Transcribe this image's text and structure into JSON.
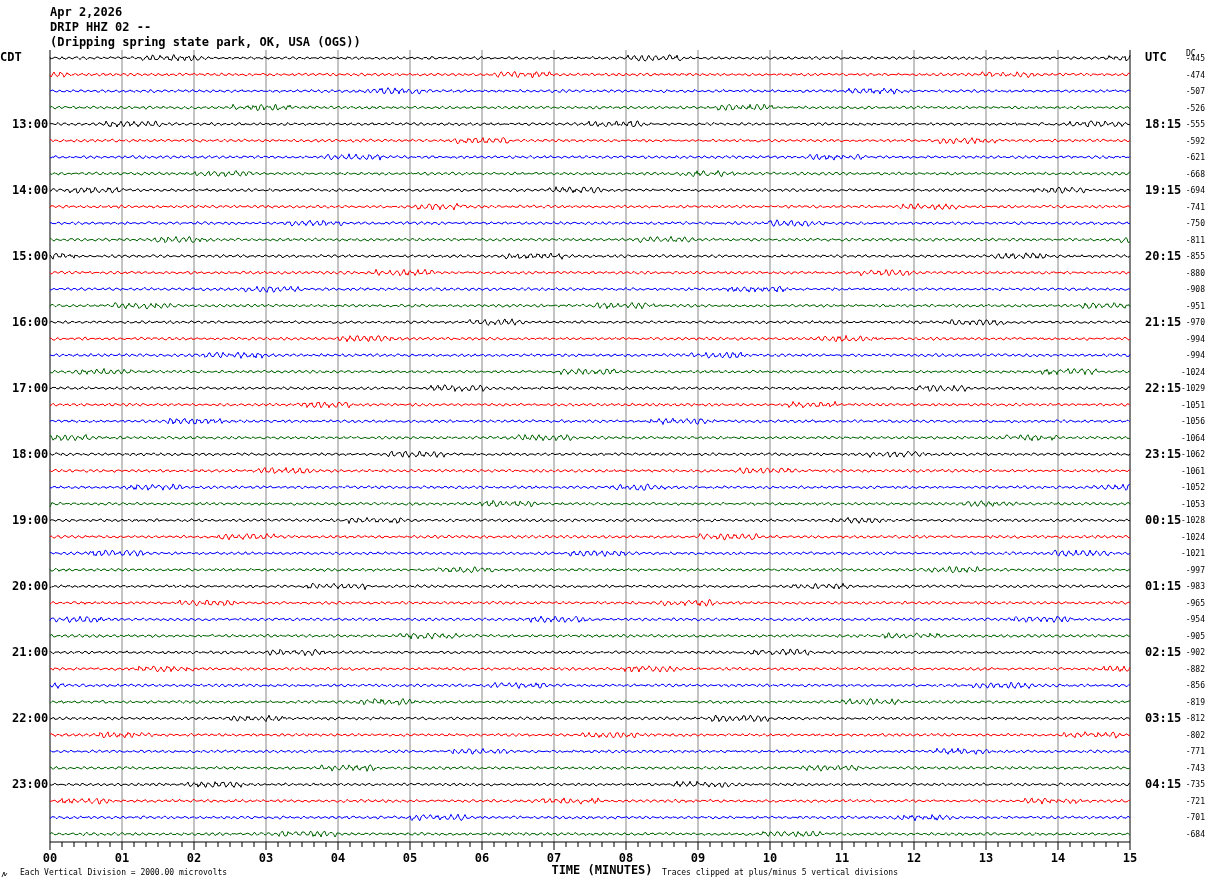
{
  "header": {
    "date": "Apr 2,2026",
    "station": "DRIP HHZ 02 --",
    "location": "(Dripping spring state park, OK, USA (OGS))"
  },
  "left_axis_title": "CDT",
  "right_axis_title": "UTC",
  "dc_title": "DC",
  "rows": [
    {
      "cdt": "",
      "utc": "",
      "dc": "-445",
      "color": "#000000"
    },
    {
      "cdt": "",
      "utc": "",
      "dc": "-474",
      "color": "#ff0000"
    },
    {
      "cdt": "",
      "utc": "",
      "dc": "-507",
      "color": "#0000ff"
    },
    {
      "cdt": "",
      "utc": "",
      "dc": "-526",
      "color": "#006400"
    },
    {
      "cdt": "13:00",
      "utc": "18:15",
      "dc": "-555",
      "color": "#000000"
    },
    {
      "cdt": "",
      "utc": "",
      "dc": "-592",
      "color": "#ff0000"
    },
    {
      "cdt": "",
      "utc": "",
      "dc": "-621",
      "color": "#0000ff"
    },
    {
      "cdt": "",
      "utc": "",
      "dc": "-668",
      "color": "#006400"
    },
    {
      "cdt": "14:00",
      "utc": "19:15",
      "dc": "-694",
      "color": "#000000"
    },
    {
      "cdt": "",
      "utc": "",
      "dc": "-741",
      "color": "#ff0000"
    },
    {
      "cdt": "",
      "utc": "",
      "dc": "-750",
      "color": "#0000ff"
    },
    {
      "cdt": "",
      "utc": "",
      "dc": "-811",
      "color": "#006400"
    },
    {
      "cdt": "15:00",
      "utc": "20:15",
      "dc": "-855",
      "color": "#000000"
    },
    {
      "cdt": "",
      "utc": "",
      "dc": "-880",
      "color": "#ff0000"
    },
    {
      "cdt": "",
      "utc": "",
      "dc": "-908",
      "color": "#0000ff"
    },
    {
      "cdt": "",
      "utc": "",
      "dc": "-951",
      "color": "#006400"
    },
    {
      "cdt": "16:00",
      "utc": "21:15",
      "dc": "-970",
      "color": "#000000"
    },
    {
      "cdt": "",
      "utc": "",
      "dc": "-994",
      "color": "#ff0000"
    },
    {
      "cdt": "",
      "utc": "",
      "dc": "-994",
      "color": "#0000ff"
    },
    {
      "cdt": "",
      "utc": "",
      "dc": "-1024",
      "color": "#006400"
    },
    {
      "cdt": "17:00",
      "utc": "22:15",
      "dc": "-1029",
      "color": "#000000"
    },
    {
      "cdt": "",
      "utc": "",
      "dc": "-1051",
      "color": "#ff0000"
    },
    {
      "cdt": "",
      "utc": "",
      "dc": "-1056",
      "color": "#0000ff"
    },
    {
      "cdt": "",
      "utc": "",
      "dc": "-1064",
      "color": "#006400"
    },
    {
      "cdt": "18:00",
      "utc": "23:15",
      "dc": "-1062",
      "color": "#000000"
    },
    {
      "cdt": "",
      "utc": "",
      "dc": "-1061",
      "color": "#ff0000"
    },
    {
      "cdt": "",
      "utc": "",
      "dc": "-1052",
      "color": "#0000ff"
    },
    {
      "cdt": "",
      "utc": "",
      "dc": "-1053",
      "color": "#006400"
    },
    {
      "cdt": "19:00",
      "utc": "00:15",
      "dc": "-1028",
      "color": "#000000"
    },
    {
      "cdt": "",
      "utc": "",
      "dc": "-1024",
      "color": "#ff0000"
    },
    {
      "cdt": "",
      "utc": "",
      "dc": "-1021",
      "color": "#0000ff"
    },
    {
      "cdt": "",
      "utc": "",
      "dc": "-997",
      "color": "#006400"
    },
    {
      "cdt": "20:00",
      "utc": "01:15",
      "dc": "-983",
      "color": "#000000"
    },
    {
      "cdt": "",
      "utc": "",
      "dc": "-965",
      "color": "#ff0000"
    },
    {
      "cdt": "",
      "utc": "",
      "dc": "-954",
      "color": "#0000ff"
    },
    {
      "cdt": "",
      "utc": "",
      "dc": "-905",
      "color": "#006400"
    },
    {
      "cdt": "21:00",
      "utc": "02:15",
      "dc": "-902",
      "color": "#000000"
    },
    {
      "cdt": "",
      "utc": "",
      "dc": "-882",
      "color": "#ff0000"
    },
    {
      "cdt": "",
      "utc": "",
      "dc": "-856",
      "color": "#0000ff"
    },
    {
      "cdt": "",
      "utc": "",
      "dc": "-819",
      "color": "#006400"
    },
    {
      "cdt": "22:00",
      "utc": "03:15",
      "dc": "-812",
      "color": "#000000"
    },
    {
      "cdt": "",
      "utc": "",
      "dc": "-802",
      "color": "#ff0000"
    },
    {
      "cdt": "",
      "utc": "",
      "dc": "-771",
      "color": "#0000ff"
    },
    {
      "cdt": "",
      "utc": "",
      "dc": "-743",
      "color": "#006400"
    },
    {
      "cdt": "23:00",
      "utc": "04:15",
      "dc": "-735",
      "color": "#000000"
    },
    {
      "cdt": "",
      "utc": "",
      "dc": "-721",
      "color": "#ff0000"
    },
    {
      "cdt": "",
      "utc": "",
      "dc": "-701",
      "color": "#0000ff"
    },
    {
      "cdt": "",
      "utc": "",
      "dc": "-684",
      "color": "#006400"
    }
  ],
  "x_ticks": [
    "00",
    "01",
    "02",
    "03",
    "04",
    "05",
    "06",
    "07",
    "08",
    "09",
    "10",
    "11",
    "12",
    "13",
    "14",
    "15"
  ],
  "x_axis_title": "TIME (MINUTES)",
  "scale_note": "Each Vertical Division = 2000.00 microvolts",
  "clip_note": "Traces clipped at plus/minus 5 vertical divisions"
}
